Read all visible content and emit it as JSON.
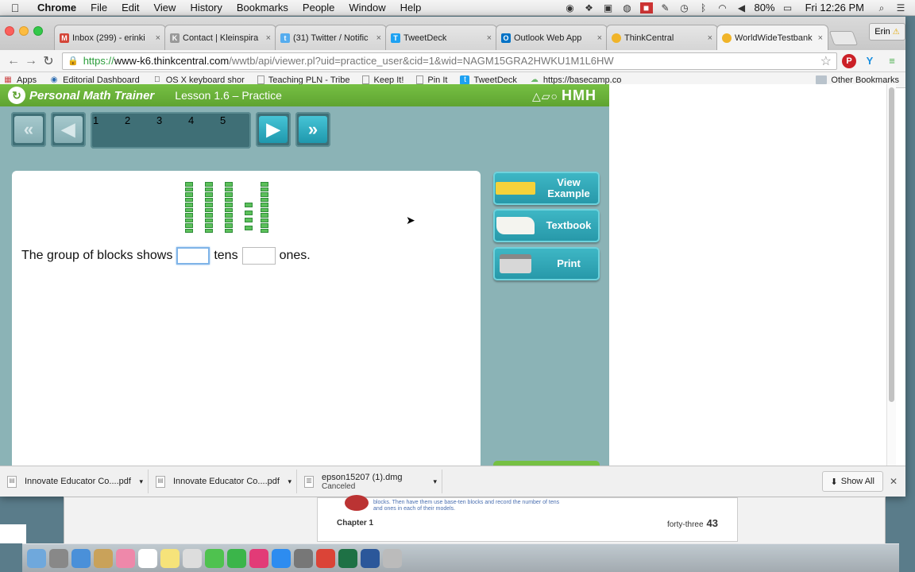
{
  "menubar": {
    "app_name": "Chrome",
    "items": [
      "File",
      "Edit",
      "View",
      "History",
      "Bookmarks",
      "People",
      "Window",
      "Help"
    ],
    "battery": "80%",
    "clock": "Fri 12:26 PM"
  },
  "browser": {
    "tabs": [
      {
        "label": "Inbox (299) - erinki",
        "favicon": "gmail-icon",
        "color": "#d44638",
        "glyph": "M"
      },
      {
        "label": "Contact | Kleinspira",
        "favicon": "page-icon",
        "color": "#999999",
        "glyph": "K"
      },
      {
        "label": "(31) Twitter / Notific",
        "favicon": "twitter-icon",
        "color": "#55acee",
        "glyph": "t"
      },
      {
        "label": "TweetDeck",
        "favicon": "tweetdeck-icon",
        "color": "#1da1f2",
        "glyph": "T"
      },
      {
        "label": "Outlook Web App",
        "favicon": "outlook-icon",
        "color": "#0072c6",
        "glyph": "O"
      },
      {
        "label": "ThinkCentral",
        "favicon": "thinkcentral-icon",
        "color": "#f0b429",
        "glyph": ""
      },
      {
        "label": "WorldWideTestbank",
        "favicon": "thinkcentral-icon",
        "color": "#f0b429",
        "glyph": ""
      }
    ],
    "profile_name": "Erin",
    "url": {
      "scheme": "https://",
      "host": "www-k6.thinkcentral.com",
      "path": "/wwtb/api/viewer.pl?uid=practice_user&cid=1&wid=NAGM15GRA2HWKU1M1L6HW"
    },
    "bookmarks": [
      {
        "label": "Apps",
        "icon": "apps-grid-icon"
      },
      {
        "label": "Editorial Dashboard",
        "icon": "globe-icon"
      },
      {
        "label": "OS X keyboard shor",
        "icon": "apple-icon"
      },
      {
        "label": "Teaching PLN - Tribe",
        "icon": "page-icon"
      },
      {
        "label": "Keep It!",
        "icon": "page-icon"
      },
      {
        "label": "Pin It",
        "icon": "page-icon"
      },
      {
        "label": "TweetDeck",
        "icon": "tweetdeck-icon"
      },
      {
        "label": "https://basecamp.co",
        "icon": "basecamp-icon"
      }
    ],
    "other_bookmarks": "Other Bookmarks"
  },
  "pmt": {
    "app_title": "Personal Math Trainer",
    "lesson": "Lesson 1.6 – Practice",
    "brand": "HMH",
    "pages": [
      "1",
      "2",
      "3",
      "4",
      "5"
    ],
    "current_page": "1",
    "question": {
      "prefix": "The group of blocks shows",
      "middle": "tens",
      "suffix": "ones.",
      "tens_rods": 4,
      "ones_units": 4
    },
    "buttons": {
      "view_example": "View Example",
      "textbook": "Textbook",
      "print": "Print"
    }
  },
  "downloads": {
    "items": [
      {
        "name": "Innovate Educator Co....pdf",
        "status": ""
      },
      {
        "name": "Innovate Educator Co....pdf",
        "status": ""
      },
      {
        "name": "epson15207 (1).dmg",
        "status": "Canceled"
      }
    ],
    "show_all": "Show All"
  },
  "background_window": {
    "note": "blocks. Then have them use base-ten blocks and record the number of tens and ones in each of their models.",
    "chapter": "Chapter 1",
    "page_words": "forty-three",
    "page_number": "43"
  },
  "dock_icons": [
    "finder-icon",
    "rocket-icon",
    "safari-icon",
    "mail-icon",
    "photos-icon",
    "calendar-icon",
    "notes-icon",
    "reminders-icon",
    "messages-icon",
    "facetime-icon",
    "itunes-icon",
    "app-store-icon",
    "preferences-icon",
    "chrome-icon",
    "excel-icon",
    "word-icon",
    "trash-icon"
  ]
}
